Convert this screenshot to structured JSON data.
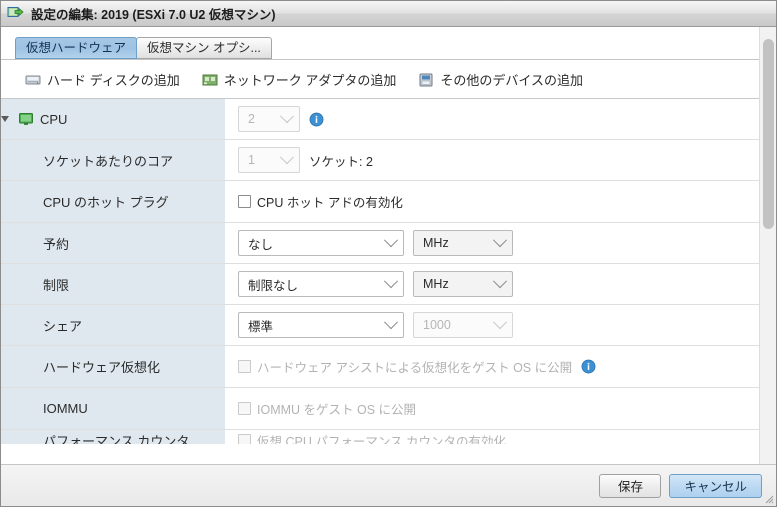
{
  "window": {
    "title": "設定の編集: 2019 (ESXi 7.0 U2 仮想マシン)",
    "title_icon": "virtual-machine-icon"
  },
  "tabs": [
    {
      "label": "仮想ハードウェア",
      "active": true
    },
    {
      "label": "仮想マシン オプシ...",
      "active": false
    }
  ],
  "toolbar": [
    {
      "label": "ハード ディスクの追加",
      "icon": "hard-disk-icon"
    },
    {
      "label": "ネットワーク アダプタの追加",
      "icon": "network-adapter-icon"
    },
    {
      "label": "その他のデバイスの追加",
      "icon": "other-device-icon"
    }
  ],
  "settings": {
    "cpu_header": {
      "label": "CPU",
      "icon": "cpu-monitor-icon",
      "caret": "expanded",
      "select_value": "2",
      "info_icon": "info-icon"
    },
    "rows": [
      {
        "label": "ソケットあたりのコア",
        "type": "select-note",
        "select_value": "1",
        "disabled": true,
        "note": "ソケット: 2"
      },
      {
        "label": "CPU のホット プラグ",
        "type": "checkbox",
        "checkbox_label": "CPU ホット アドの有効化",
        "checked": false,
        "disabled": false
      },
      {
        "label": "予約",
        "type": "select-select",
        "select_value": "なし",
        "unit_value": "MHz",
        "disabled": false
      },
      {
        "label": "制限",
        "type": "select-select",
        "select_value": "制限なし",
        "unit_value": "MHz",
        "disabled": false
      },
      {
        "label": "シェア",
        "type": "select-select",
        "select_value": "標準",
        "unit_value": "1000",
        "unit_disabled": true
      },
      {
        "label": "ハードウェア仮想化",
        "type": "checkbox",
        "checkbox_label": "ハードウェア アシストによる仮想化をゲスト OS に公開",
        "checked": false,
        "disabled": true,
        "info_icon": "info-icon"
      },
      {
        "label": "IOMMU",
        "type": "checkbox",
        "checkbox_label": "IOMMU をゲスト OS に公開",
        "checked": false,
        "disabled": true
      },
      {
        "label": "パフォーマンス カウンタ",
        "type": "checkbox",
        "checkbox_label": "仮想 CPU パフォーマンス カウンタの有効化",
        "checked": false,
        "disabled": true,
        "clipped": true
      }
    ]
  },
  "footer": {
    "save_label": "保存",
    "cancel_label": "キャンセル"
  },
  "colors": {
    "label_column": "#dfe8ef",
    "active_tab": "#9dc2e4",
    "primary_button": "#bcd9f2",
    "info_icon": "#3c91d4"
  }
}
